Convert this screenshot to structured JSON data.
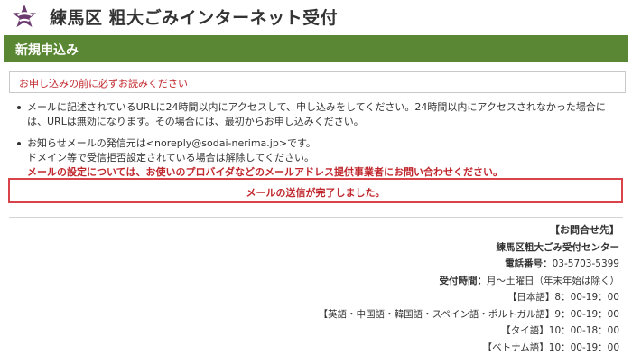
{
  "header": {
    "title": "練馬区 粗大ごみインターネット受付"
  },
  "section": {
    "title": "新規申込み"
  },
  "notice": {
    "text": "お申し込みの前に必ずお読みください"
  },
  "bullets": {
    "item1": "メールに記述されているURLに24時間以内にアクセスして、申し込みをしてください。24時間以内にアクセスされなかった場合には、URLは無効になります。その場合には、最初からお申し込みください。",
    "item2_line1": "お知らせメールの発信元は<noreply@sodai-nerima.jp>です。",
    "item2_line2": "ドメイン等で受信拒否設定されている場合は解除してください。",
    "item2_line3": "メールの設定については、お使いのプロバイダなどのメールアドレス提供事業者にお問い合わせください。"
  },
  "status": {
    "text": "メールの送信が完了しました。"
  },
  "contact": {
    "title": "【お問合せ先】",
    "org": "練馬区粗大ごみ受付センター",
    "phone_label": "電話番号：",
    "phone": "03-5703-5399",
    "hours_label": "受付時間：",
    "hours": "月～土曜日（年末年始は除く）",
    "lines": [
      "【日本語】8：00-19：00",
      "【英語・中国語・韓国語・スペイン語・ポルトガル語】9：00-19：00",
      "【タイ語】10：00-18：00",
      "【ベトナム語】10：00-19：00"
    ]
  },
  "colors": {
    "brand_green": "#5a8733",
    "alert_red": "#c0272d",
    "logo_purple": "#6b3a6e"
  },
  "icons": {
    "logo": "nerima-ward-emblem"
  }
}
